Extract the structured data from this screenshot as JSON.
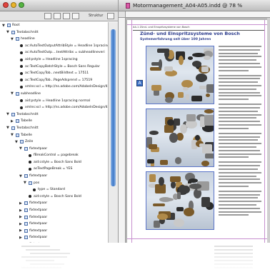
{
  "structure_panel": {
    "toolbar_label": "Struktur",
    "tree": [
      {
        "depth": 0,
        "kind": "expanded",
        "icon": "box",
        "label": "Root"
      },
      {
        "depth": 1,
        "kind": "expanded",
        "icon": "box",
        "label": "Textabschnitt"
      },
      {
        "depth": 2,
        "kind": "expanded",
        "icon": "box",
        "label": "headline"
      },
      {
        "depth": 3,
        "kind": "attr",
        "icon": "dot",
        "label": "ac:AutoTextOutputAttribStyle = Headline 1spracing"
      },
      {
        "depth": 3,
        "kind": "attr",
        "icon": "dot",
        "label": "ac:AutoTextOutp....textAttribs = subheadlineveri"
      },
      {
        "depth": 3,
        "kind": "attr",
        "icon": "dot",
        "label": "aid:pstyle = Headline 1spracing"
      },
      {
        "depth": 3,
        "kind": "attr",
        "icon": "dot",
        "label": "ac:TextCopyBatchStyle = Bosch Sans Regular"
      },
      {
        "depth": 3,
        "kind": "attr",
        "icon": "dot",
        "label": "ac:TextCopyTob...nextBildtext = 17511"
      },
      {
        "depth": 3,
        "kind": "attr",
        "icon": "dot",
        "label": "ac:TextCopyTob...PageAdsprend = 17519"
      },
      {
        "depth": 3,
        "kind": "attr",
        "icon": "dot",
        "label": "xmlns:xcl = http://ns.adobe.com/AdobeInDesign/4"
      },
      {
        "depth": 2,
        "kind": "expanded",
        "icon": "box",
        "label": "subheadline"
      },
      {
        "depth": 3,
        "kind": "attr",
        "icon": "dot",
        "label": "aid:pstyle = Headline 1spracing normal"
      },
      {
        "depth": 3,
        "kind": "attr",
        "icon": "dot",
        "label": "xmlns:xcl = http://ns.adobe.com/AdobeInDesign/4"
      },
      {
        "depth": 1,
        "kind": "expanded",
        "icon": "box",
        "label": "Textabschnitt"
      },
      {
        "depth": 2,
        "kind": "collapsed",
        "icon": "box",
        "label": "Tabelle"
      },
      {
        "depth": 1,
        "kind": "expanded",
        "icon": "box",
        "label": "Textabschnitt"
      },
      {
        "depth": 2,
        "kind": "expanded",
        "icon": "box",
        "label": "Tabelle"
      },
      {
        "depth": 3,
        "kind": "expanded",
        "icon": "box",
        "label": "Zeile"
      },
      {
        "depth": 4,
        "kind": "expanded",
        "icon": "box",
        "label": "fixtextpaar"
      },
      {
        "depth": 5,
        "kind": "attr",
        "icon": "dot",
        "label": "fBreakControl = pagebreak"
      },
      {
        "depth": 5,
        "kind": "attr",
        "icon": "dot",
        "label": "aid:cstyle = Bosch Sans Bold"
      },
      {
        "depth": 5,
        "kind": "attr",
        "icon": "dot",
        "label": "acTextPageBreak = YES"
      },
      {
        "depth": 4,
        "kind": "expanded",
        "icon": "box",
        "label": "fixtextpaar"
      },
      {
        "depth": 5,
        "kind": "expanded",
        "icon": "box",
        "label": "pos"
      },
      {
        "depth": 6,
        "kind": "attr",
        "icon": "dot",
        "label": "type = Standard"
      },
      {
        "depth": 5,
        "kind": "attr",
        "icon": "dot",
        "label": "aid:cstyle = Bosch Sans Bold"
      },
      {
        "depth": 4,
        "kind": "collapsed",
        "icon": "box",
        "label": "fixtextpaar"
      },
      {
        "depth": 4,
        "kind": "collapsed",
        "icon": "box",
        "label": "fixtextpaar"
      },
      {
        "depth": 4,
        "kind": "collapsed",
        "icon": "box",
        "label": "fixtextpaar"
      },
      {
        "depth": 4,
        "kind": "collapsed",
        "icon": "box",
        "label": "fixtextpaar"
      },
      {
        "depth": 4,
        "kind": "collapsed",
        "icon": "box",
        "label": "fixtextpaar"
      },
      {
        "depth": 4,
        "kind": "collapsed",
        "icon": "box",
        "label": "fixtextpaar"
      },
      {
        "depth": 4,
        "kind": "collapsed",
        "icon": "box",
        "label": "fixtextpaar"
      },
      {
        "depth": 4,
        "kind": "collapsed",
        "icon": "box",
        "label": "fixtextpaar"
      },
      {
        "depth": 4,
        "kind": "collapsed",
        "icon": "box",
        "label": "fixtextpaar"
      },
      {
        "depth": 4,
        "kind": "collapsed",
        "icon": "box",
        "label": "fixtextpaar"
      }
    ]
  },
  "document": {
    "window_title": "Motormanagement_A04-A05.indd @ 78 %",
    "page_header": "A4-1 Zünd- und Einspritzsysteme von Bosch",
    "heading": "Zünd- und Einspritzsysteme von Bosch",
    "subheading": "Systemerfahrung seit über 100 Jahren",
    "frame_tag": "A",
    "text_lines": 48
  },
  "colors": {
    "close": "#e0443e",
    "minimize": "#e9b42a",
    "zoom": "#55b442",
    "accent": "#3e79c8",
    "heading": "#2c3c8c",
    "margin_guide": "#c78fcf"
  }
}
